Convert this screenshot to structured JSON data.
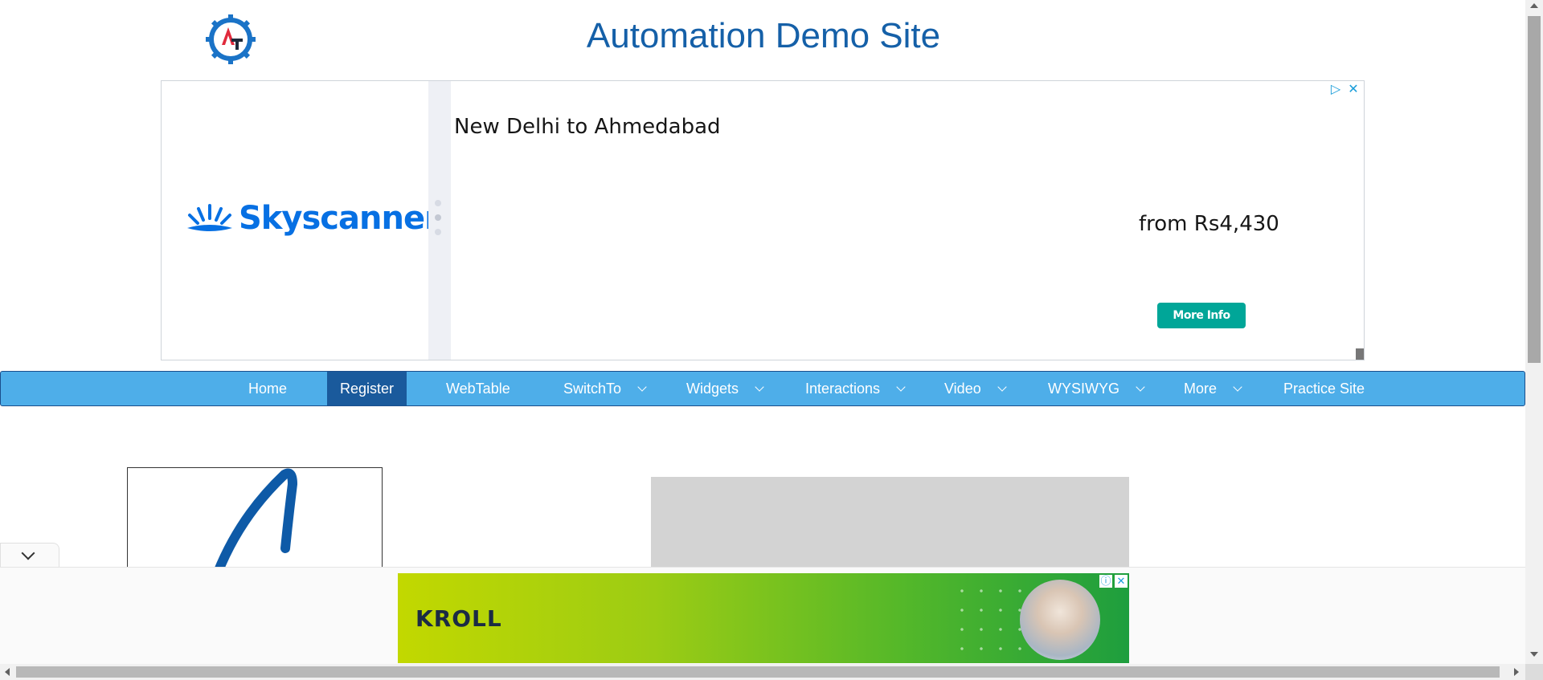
{
  "header": {
    "title": "Automation Demo Site",
    "logo_text": "AT"
  },
  "top_ad": {
    "brand": "Skyscanner",
    "route": "New Delhi to Ahmedabad",
    "price": "from Rs4,430",
    "button": "More Info",
    "brand_color": "#0770e3",
    "button_color": "#00a698"
  },
  "nav": {
    "items": [
      {
        "label": "Home",
        "dropdown": false
      },
      {
        "label": "Register",
        "dropdown": false,
        "active": true
      },
      {
        "label": "WebTable",
        "dropdown": false
      },
      {
        "label": "SwitchTo",
        "dropdown": true
      },
      {
        "label": "Widgets",
        "dropdown": true
      },
      {
        "label": "Interactions",
        "dropdown": true
      },
      {
        "label": "Video",
        "dropdown": true
      },
      {
        "label": "WYSIWYG",
        "dropdown": true
      },
      {
        "label": "More",
        "dropdown": true
      },
      {
        "label": "Practice Site",
        "dropdown": false
      }
    ],
    "background": "#4eaee9",
    "active_background": "#1a5a9c"
  },
  "bottom_ad": {
    "brand": "KROLL"
  },
  "title_color": "#1560a8"
}
